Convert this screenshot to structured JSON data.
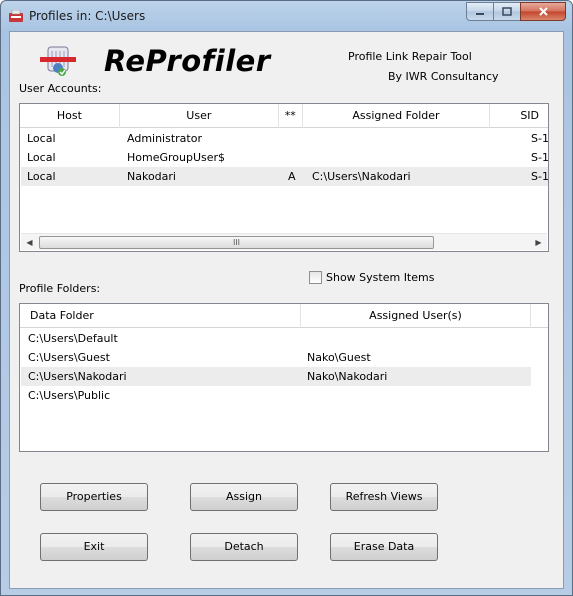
{
  "window": {
    "title": "Profiles in: C:\\Users"
  },
  "header": {
    "brand": "ReProfiler",
    "tagline": "Profile Link Repair Tool",
    "byline": "By IWR Consultancy"
  },
  "accounts": {
    "label": "User Accounts:",
    "columns": [
      "Host",
      "User",
      "**",
      "Assigned Folder",
      "SID"
    ],
    "rows": [
      {
        "host": "Local",
        "user": "Administrator",
        "flag": "",
        "folder": "",
        "sid": "S-1"
      },
      {
        "host": "Local",
        "user": "HomeGroupUser$",
        "flag": "",
        "folder": "",
        "sid": "S-1"
      },
      {
        "host": "Local",
        "user": "Nakodari",
        "flag": "A",
        "folder": "C:\\Users\\Nakodari",
        "sid": "S-1"
      }
    ],
    "scroll_grip": "III"
  },
  "folders": {
    "label": "Profile Folders:",
    "show_system": "Show System Items",
    "columns": [
      "Data Folder",
      "Assigned User(s)"
    ],
    "rows": [
      {
        "folder": "C:\\Users\\Default",
        "user": ""
      },
      {
        "folder": "C:\\Users\\Guest",
        "user": "Nako\\Guest"
      },
      {
        "folder": "C:\\Users\\Nakodari",
        "user": "Nako\\Nakodari"
      },
      {
        "folder": "C:\\Users\\Public",
        "user": ""
      }
    ]
  },
  "buttons": {
    "properties": "Properties",
    "assign": "Assign",
    "refresh": "Refresh Views",
    "exit": "Exit",
    "detach": "Detach",
    "erase": "Erase Data"
  },
  "colors": {
    "title_bar": "#bcd3ea",
    "close_button": "#c4452a",
    "brand_red": "#d8282e"
  }
}
